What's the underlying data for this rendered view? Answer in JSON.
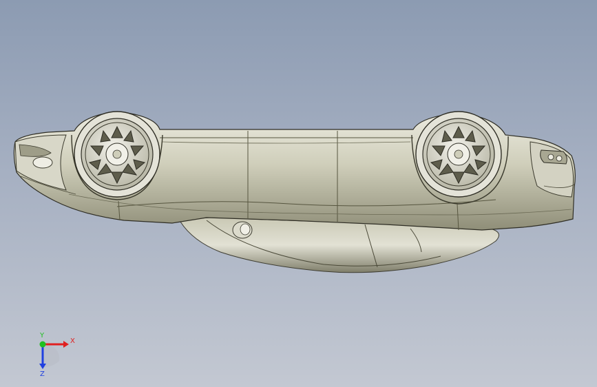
{
  "viewport": {
    "background_top": "#8c9bb2",
    "background_bottom": "#c3c8d2"
  },
  "model": {
    "body_color": "#c9c8b6",
    "wheel_color": "#d9d8cc"
  },
  "triad": {
    "x_label": "X",
    "y_label": "Y",
    "z_label": "Z",
    "x_color": "#e02020",
    "y_color": "#20c020",
    "z_color": "#2040e0"
  }
}
